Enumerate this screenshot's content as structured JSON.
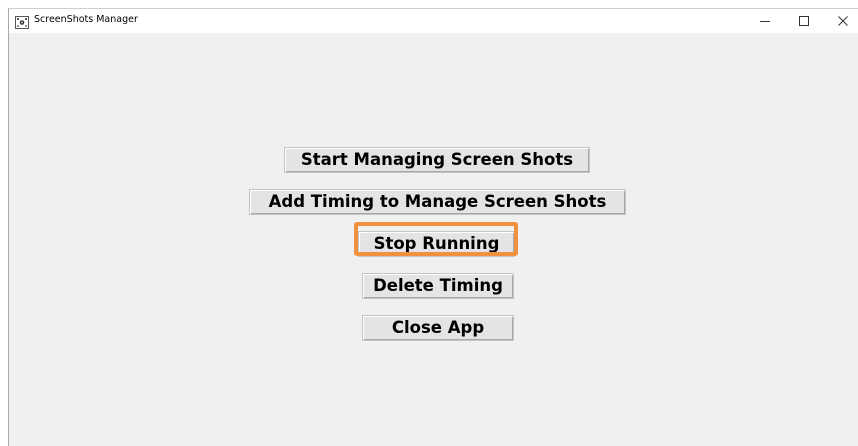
{
  "window": {
    "title": "ScreenShots Manager",
    "icon": "screenshot-app-icon",
    "controls": {
      "minimize_icon": "minimize-icon",
      "maximize_icon": "maximize-icon",
      "close_icon": "close-icon"
    }
  },
  "buttons": {
    "start": "Start Managing Screen Shots",
    "add_timing": "Add Timing to Manage Screen Shots",
    "stop": "Stop Running",
    "delete_timing": "Delete Timing",
    "close_app": "Close App"
  },
  "highlight": {
    "target": "stop",
    "color": "#f0913f"
  },
  "colors": {
    "window_bg": "#f0f0f0",
    "button_bg": "#e4e4e4",
    "titlebar_bg": "#ffffff"
  }
}
